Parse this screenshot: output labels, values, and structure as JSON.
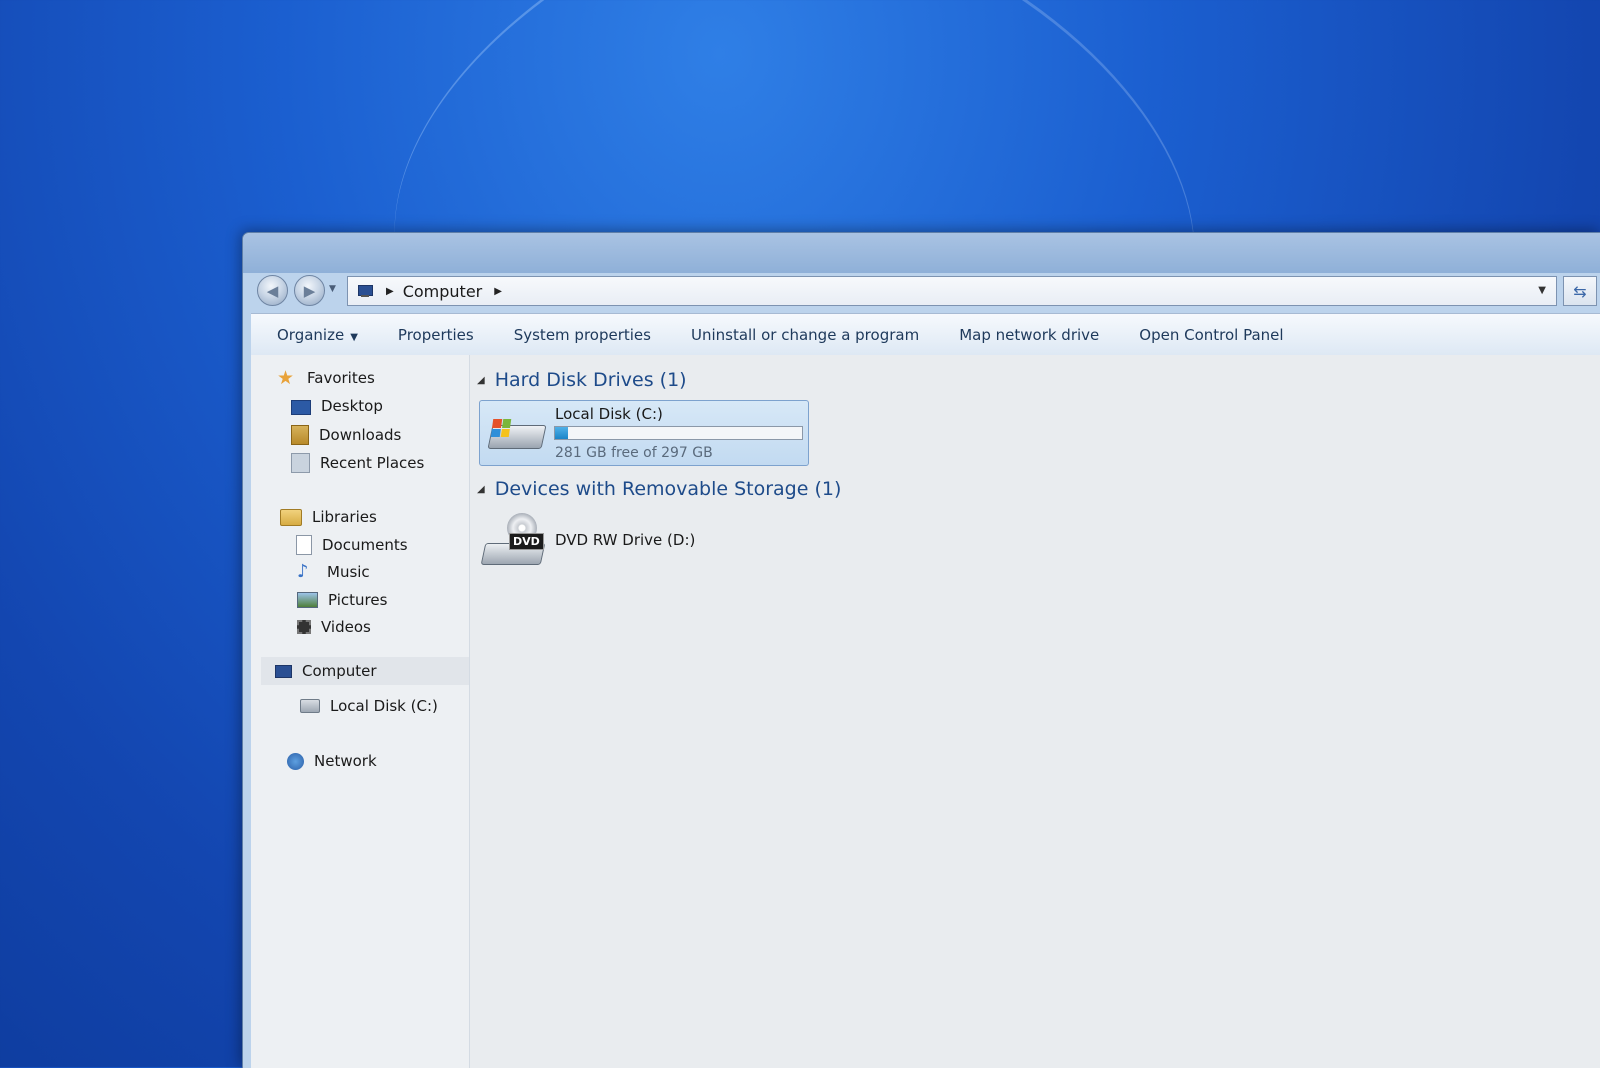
{
  "address_bar": {
    "breadcrumbs": [
      "Computer"
    ]
  },
  "command_bar": {
    "organize": "Organize",
    "properties": "Properties",
    "system_properties": "System properties",
    "uninstall": "Uninstall or change a program",
    "map_drive": "Map network drive",
    "control_panel": "Open Control Panel"
  },
  "nav_pane": {
    "favorites": {
      "label": "Favorites",
      "items": [
        {
          "label": "Desktop",
          "icon": "desktop-icon"
        },
        {
          "label": "Downloads",
          "icon": "downloads-icon"
        },
        {
          "label": "Recent Places",
          "icon": "recent-places-icon"
        }
      ]
    },
    "libraries": {
      "label": "Libraries",
      "items": [
        {
          "label": "Documents",
          "icon": "documents-icon"
        },
        {
          "label": "Music",
          "icon": "music-icon"
        },
        {
          "label": "Pictures",
          "icon": "pictures-icon"
        },
        {
          "label": "Videos",
          "icon": "videos-icon"
        }
      ]
    },
    "computer": {
      "label": "Computer",
      "items": [
        {
          "label": "Local Disk (C:)",
          "icon": "local-disk-icon"
        }
      ]
    },
    "network": {
      "label": "Network"
    }
  },
  "groups": [
    {
      "title": "Hard Disk Drives (1)",
      "items": [
        {
          "name": "Local Disk (C:)",
          "free_text": "281 GB free of 297 GB",
          "used_fraction": 0.054,
          "icon": "hard-disk-icon"
        }
      ]
    },
    {
      "title": "Devices with Removable Storage (1)",
      "items": [
        {
          "name": "DVD RW Drive (D:)",
          "icon_label": "DVD",
          "icon": "dvd-drive-icon"
        }
      ]
    }
  ],
  "colors": {
    "group_header": "#1e4b8a",
    "usage_fill": "#1b85c8",
    "selection": "#c2daf1"
  }
}
